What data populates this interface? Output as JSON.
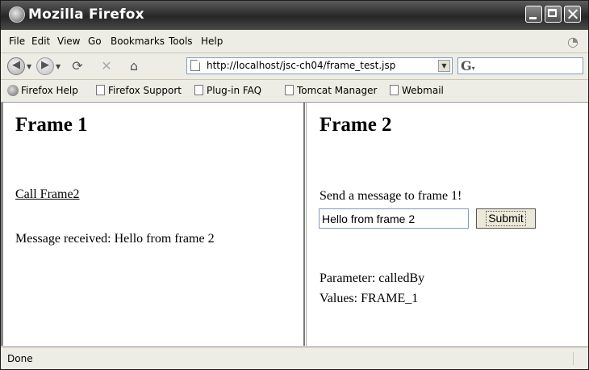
{
  "window": {
    "title": "Mozilla Firefox"
  },
  "menu": [
    {
      "label": "File"
    },
    {
      "label": "Edit"
    },
    {
      "label": "View"
    },
    {
      "label": "Go"
    },
    {
      "label": "Bookmarks"
    },
    {
      "label": "Tools"
    },
    {
      "label": "Help"
    }
  ],
  "nav": {
    "url": "http://localhost/jsc-ch04/frame_test.jsp",
    "search_engine": "G"
  },
  "bookmarks": [
    {
      "label": "Firefox Help",
      "icon": "firefox-icon"
    },
    {
      "label": "Firefox Support",
      "icon": "page-icon"
    },
    {
      "label": "Plug-in FAQ",
      "icon": "page-icon"
    },
    {
      "label": "Tomcat Manager",
      "icon": "page-icon"
    },
    {
      "label": "Webmail",
      "icon": "page-icon"
    }
  ],
  "frame1": {
    "heading": "Frame 1",
    "link": "Call Frame2",
    "message": "Message received:  Hello from frame 2"
  },
  "frame2": {
    "heading": "Frame 2",
    "prompt": "Send a message to frame 1!",
    "input_value": "Hello from frame 2",
    "submit_label": "Submit",
    "param": "Parameter: calledBy",
    "values": "Values: FRAME_1"
  },
  "status": {
    "text": "Done"
  },
  "colors": {
    "titlebar": "#2f2f2f",
    "chrome": "#eeede5",
    "page": "#ffffff"
  }
}
